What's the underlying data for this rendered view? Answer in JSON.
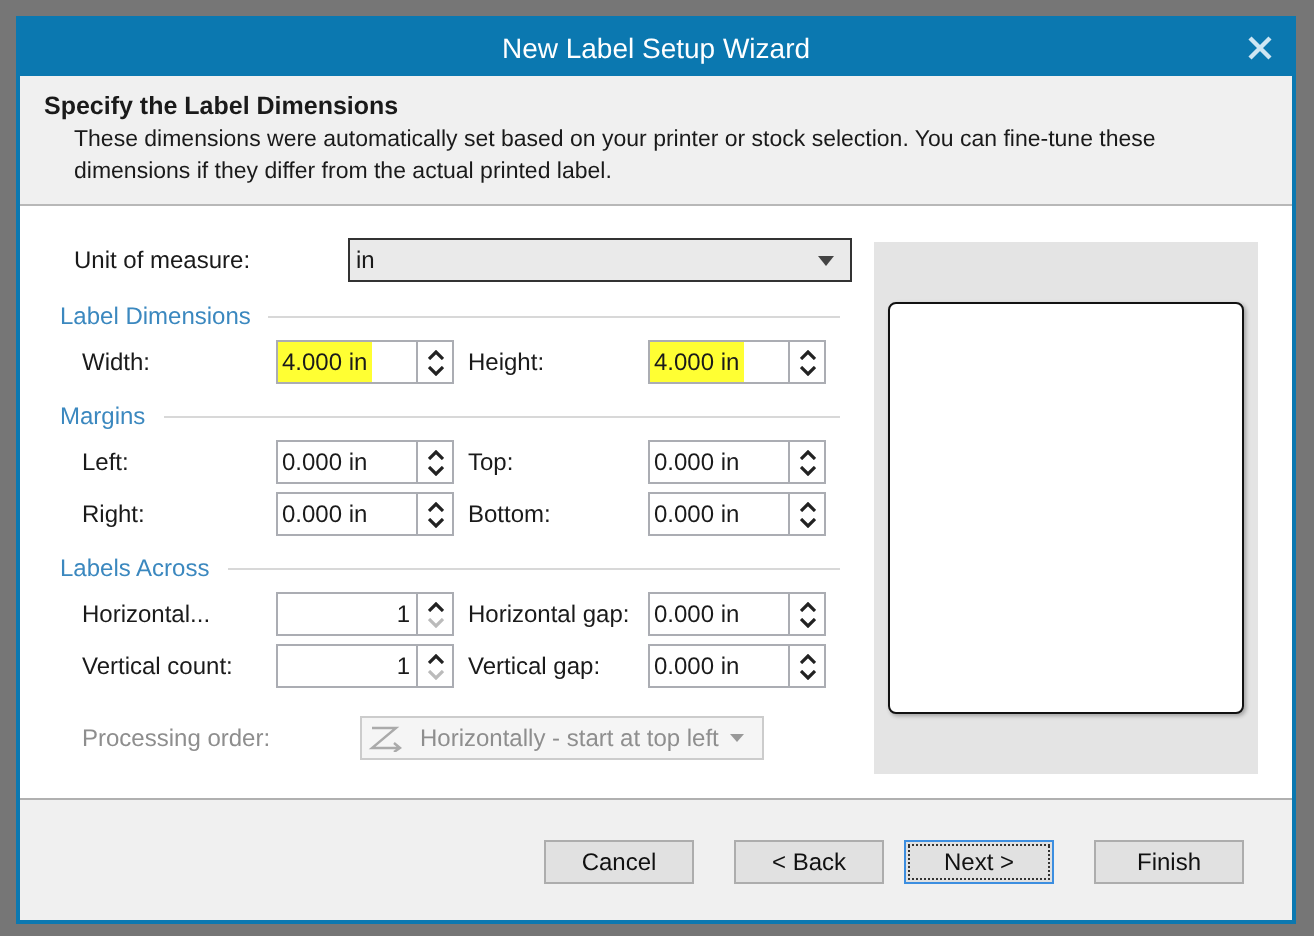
{
  "window": {
    "title": "New Label Setup Wizard"
  },
  "header": {
    "title": "Specify the Label Dimensions",
    "description": "These dimensions were automatically set based on your printer or stock selection. You can fine-tune these dimensions if they differ from the actual printed label."
  },
  "unit_of_measure": {
    "label": "Unit of measure:",
    "value": "in"
  },
  "sections": [
    {
      "title": "Label Dimensions",
      "fields": [
        {
          "label": "Width:",
          "value": "4.000 in",
          "kind": "measure",
          "highlighted": true,
          "down_disabled": false
        },
        {
          "label": "Height:",
          "value": "4.000 in",
          "kind": "measure",
          "highlighted": true,
          "down_disabled": false
        }
      ]
    },
    {
      "title": "Margins",
      "fields": [
        {
          "label": "Left:",
          "value": "0.000 in",
          "kind": "measure",
          "highlighted": false,
          "down_disabled": false
        },
        {
          "label": "Top:",
          "value": "0.000 in",
          "kind": "measure",
          "highlighted": false,
          "down_disabled": false
        },
        {
          "label": "Right:",
          "value": "0.000 in",
          "kind": "measure",
          "highlighted": false,
          "down_disabled": false
        },
        {
          "label": "Bottom:",
          "value": "0.000 in",
          "kind": "measure",
          "highlighted": false,
          "down_disabled": false
        }
      ]
    },
    {
      "title": "Labels Across",
      "fields": [
        {
          "label": "Horizontal...",
          "value": "1",
          "kind": "count",
          "highlighted": false,
          "down_disabled": true
        },
        {
          "label": "Horizontal gap:",
          "value": "0.000 in",
          "kind": "measure",
          "highlighted": false,
          "down_disabled": false
        },
        {
          "label": "Vertical count:",
          "value": "1",
          "kind": "count",
          "highlighted": false,
          "down_disabled": true
        },
        {
          "label": "Vertical gap:",
          "value": "0.000 in",
          "kind": "measure",
          "highlighted": false,
          "down_disabled": false
        }
      ]
    }
  ],
  "processing_order": {
    "label": "Processing order:",
    "value": "Horizontally - start at top left",
    "disabled": true
  },
  "buttons": [
    {
      "label": "Cancel",
      "focused": false
    },
    {
      "label": "< Back",
      "focused": false
    },
    {
      "label": "Next >",
      "focused": true
    },
    {
      "label": "Finish",
      "focused": false
    }
  ]
}
